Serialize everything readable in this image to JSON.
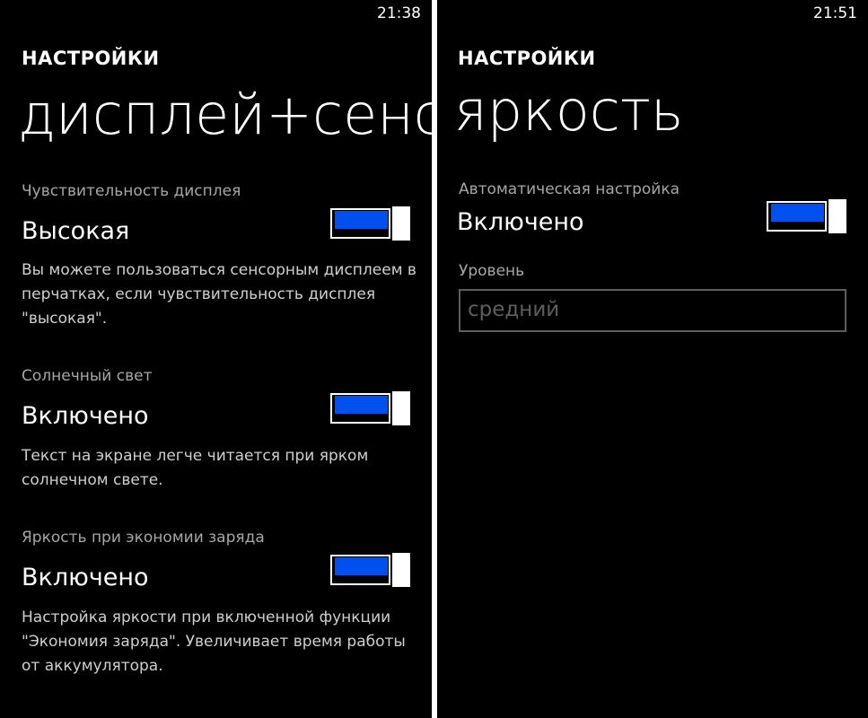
{
  "left_screen": {
    "clock": "21:38",
    "app_title": "НАСТРОЙКИ",
    "page_title": "дисплей+сенс",
    "settings": [
      {
        "label": "Чувствительность дисплея",
        "value": "Высокая",
        "toggle_on": true,
        "description": "Вы можете пользоваться сенсорным дисплеем в перчатках, если чувствительность дисплея \"высокая\"."
      },
      {
        "label": "Солнечный свет",
        "value": "Включено",
        "toggle_on": true,
        "description": "Текст на экране легче читается при ярком солнечном свете."
      },
      {
        "label": "Яркость при экономии заряда",
        "value": "Включено",
        "toggle_on": true,
        "description": "Настройка яркости при включенной функции \"Экономия заряда\". Увеличивает время работы от аккумулятора."
      }
    ]
  },
  "right_screen": {
    "clock": "21:51",
    "app_title": "НАСТРОЙКИ",
    "page_title": "яркость",
    "auto": {
      "label": "Автоматическая настройка",
      "value": "Включено",
      "toggle_on": true
    },
    "level": {
      "label": "Уровень",
      "value": "средний"
    }
  },
  "colors": {
    "background": "#000000",
    "foreground": "#ffffff",
    "accent": "#0050ef",
    "subtle_text": "#a6a6a6",
    "disabled": "#5e5e5e"
  }
}
